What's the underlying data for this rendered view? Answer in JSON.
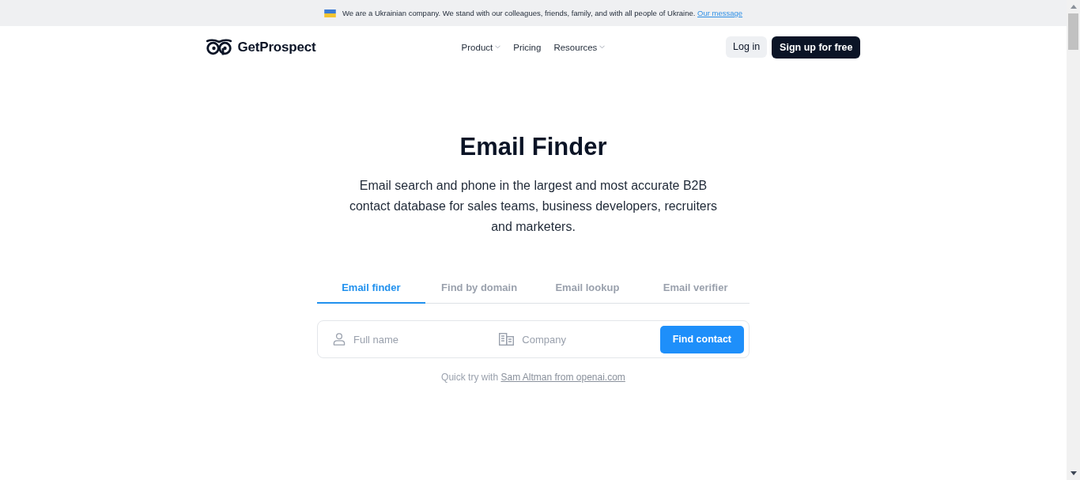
{
  "banner": {
    "text": "We are a Ukrainian company. We stand with our colleagues, friends, family, and with all people of Ukraine.",
    "link": "Our message"
  },
  "header": {
    "logo": "GetProspect",
    "nav": [
      {
        "label": "Product",
        "dropdown": true
      },
      {
        "label": "Pricing",
        "dropdown": false
      },
      {
        "label": "Resources",
        "dropdown": true
      }
    ],
    "login": "Log in",
    "signup": "Sign up for free"
  },
  "hero": {
    "title": "Email Finder",
    "subtitle": "Email search and phone in the largest and most accurate B2B contact database for sales teams, business developers, recruiters and marketers."
  },
  "tabs": [
    {
      "label": "Email finder",
      "selected": true
    },
    {
      "label": "Find by domain",
      "selected": false
    },
    {
      "label": "Email lookup",
      "selected": false
    },
    {
      "label": "Email verifier",
      "selected": false
    }
  ],
  "search": {
    "fields": [
      {
        "kind": "person",
        "placeholder": "Full name"
      },
      {
        "kind": "company",
        "placeholder": "Company"
      }
    ],
    "button": "Find contact"
  },
  "quick_try": {
    "text": "Quick try with",
    "link": "Sam Altman from openai.com"
  }
}
